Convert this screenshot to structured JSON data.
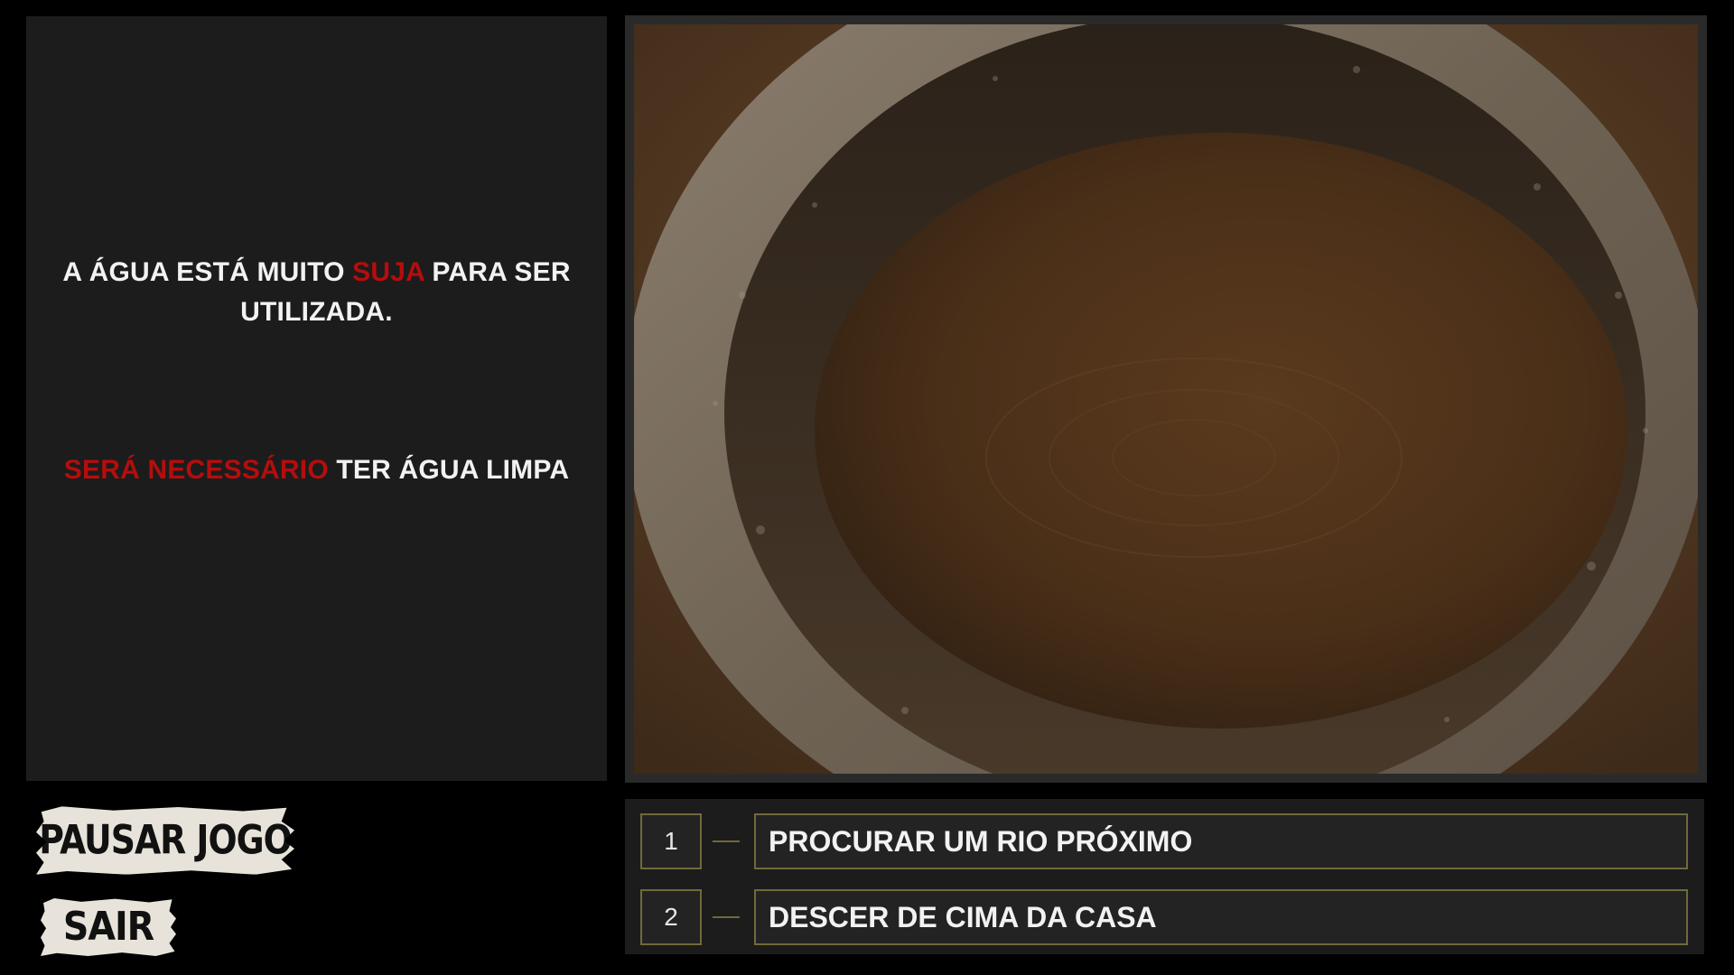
{
  "narration": {
    "line1_pre": "A ÁGUA ESTÁ MUITO ",
    "line1_highlight": "SUJA",
    "line1_post": " PARA SER UTILIZADA.",
    "line2_highlight": "SERÁ NECESSÁRIO",
    "line2_post": " TER ÁGUA LIMPA"
  },
  "scene": {
    "icon": "dirty-water-barrel-image"
  },
  "menu": {
    "pause_label": "PAUSAR JOGO",
    "exit_label": "SAIR"
  },
  "choices": [
    {
      "number": "1",
      "label": "PROCURAR UM RIO PRÓXIMO"
    },
    {
      "number": "2",
      "label": "DESCER DE CIMA DA CASA"
    }
  ],
  "colors": {
    "highlight": "#b50d0d",
    "choice_border": "#6f6a3a",
    "panel_bg": "#1c1c1c"
  }
}
